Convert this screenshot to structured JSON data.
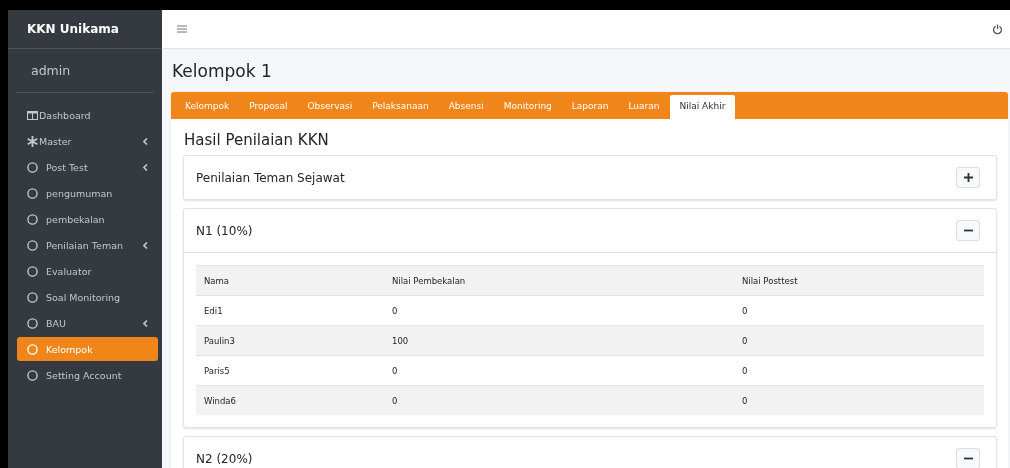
{
  "sidebar": {
    "brand": "KKN Unikama",
    "user": "admin",
    "items": [
      {
        "label": "Dashboard",
        "kind": "grid",
        "has_submenu": false,
        "selected": false
      },
      {
        "label": "Master",
        "kind": "asterisk",
        "has_submenu": true,
        "selected": false
      },
      {
        "label": "Post Test",
        "kind": "circle",
        "has_submenu": true,
        "selected": false
      },
      {
        "label": "pengumuman",
        "kind": "circle",
        "has_submenu": false,
        "selected": false
      },
      {
        "label": "pembekalan",
        "kind": "circle",
        "has_submenu": false,
        "selected": false
      },
      {
        "label": "Penilaian Teman",
        "kind": "circle",
        "has_submenu": true,
        "selected": false
      },
      {
        "label": "Evaluator",
        "kind": "circle",
        "has_submenu": false,
        "selected": false
      },
      {
        "label": "Soal Monitoring",
        "kind": "circle",
        "has_submenu": false,
        "selected": false
      },
      {
        "label": "BAU",
        "kind": "circle",
        "has_submenu": true,
        "selected": false
      },
      {
        "label": "Kelompok",
        "kind": "circle",
        "has_submenu": false,
        "selected": true
      },
      {
        "label": "Setting Account",
        "kind": "circle",
        "has_submenu": false,
        "selected": false
      }
    ]
  },
  "page_title": "Kelompok 1",
  "tabs": [
    {
      "label": "Kelompok",
      "selected": false
    },
    {
      "label": "Proposal",
      "selected": false
    },
    {
      "label": "Observasi",
      "selected": false
    },
    {
      "label": "Pelaksanaan",
      "selected": false
    },
    {
      "label": "Absensi",
      "selected": false
    },
    {
      "label": "Monitoring",
      "selected": false
    },
    {
      "label": "Laporan",
      "selected": false
    },
    {
      "label": "Luaran",
      "selected": false
    },
    {
      "label": "Nilai Akhir",
      "selected": true
    }
  ],
  "section_title": "Hasil Penilaian KKN",
  "panels": [
    {
      "title": "Penilaian Teman Sejawat",
      "collapsed": true
    },
    {
      "title": "N1 (10%)",
      "collapsed": false,
      "table": {
        "columns": [
          "Nama",
          "Nilai Pembekalan",
          "Nilai Posttest"
        ],
        "rows": [
          [
            "Edi1",
            "0",
            "0"
          ],
          [
            "Paulin3",
            "100",
            "0"
          ],
          [
            "Paris5",
            "0",
            "0"
          ],
          [
            "Winda6",
            "0",
            "0"
          ]
        ]
      }
    },
    {
      "title": "N2 (20%)",
      "collapsed": false
    }
  ]
}
